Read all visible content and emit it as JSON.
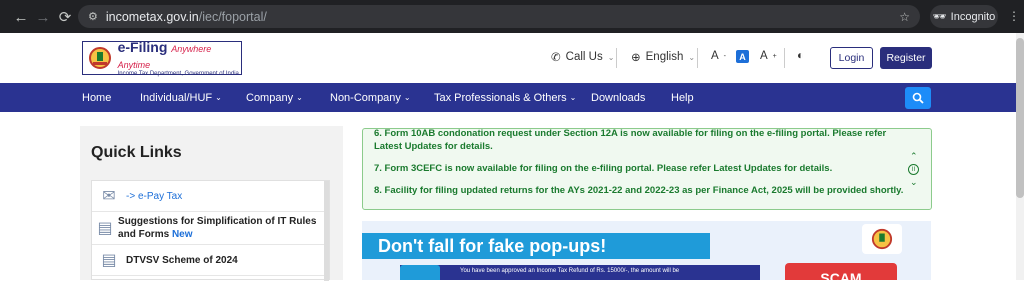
{
  "browser": {
    "url_host": "incometax.gov.in",
    "url_path": "/iec/foportal/",
    "incognito_label": "Incognito"
  },
  "header": {
    "logo_title": "e-Filing",
    "logo_tagline": "Anywhere Anytime",
    "logo_subtitle": "Income Tax Department, Government of India",
    "call_us": "Call Us",
    "language": "English",
    "font_decrease": "A",
    "font_normal": "A",
    "font_increase": "A",
    "login": "Login",
    "register": "Register"
  },
  "nav": {
    "items": [
      {
        "label": "Home"
      },
      {
        "label": "Individual/HUF"
      },
      {
        "label": "Company"
      },
      {
        "label": "Non-Company"
      },
      {
        "label": "Tax Professionals & Others"
      },
      {
        "label": "Downloads"
      },
      {
        "label": "Help"
      }
    ]
  },
  "quick_links": {
    "title": "Quick Links",
    "items": [
      {
        "label": "-> e-Pay Tax"
      },
      {
        "label": "Suggestions for Simplification of IT Rules and Forms",
        "badge": "New"
      },
      {
        "label": "DTVSV Scheme of 2024"
      }
    ]
  },
  "news": {
    "items": [
      "6. Form 10AB condonation request under Section 12A is now available for filing on the e-filing portal. Please refer",
      "Latest Updates for details.",
      "7. Form 3CEFC is now available for filing on the e-filing portal. Please refer Latest Updates for details.",
      "8. Facility for filing updated returns for the AYs 2021-22 and 2022-23 as per Finance Act, 2025 will be provided shortly."
    ]
  },
  "banner": {
    "title": "Don't fall for fake pop-ups!",
    "notice": "You have been approved an Income Tax Refund of Rs. 15000/-, the amount will be",
    "scam_label": "SCAM"
  }
}
